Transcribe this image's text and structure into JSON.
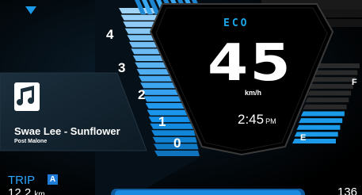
{
  "speedometer": {
    "ticks": [
      "0",
      "1",
      "2",
      "3",
      "4"
    ],
    "speed": "45",
    "unit": "km/h",
    "mode": "ECO"
  },
  "clock": {
    "time": "2:45",
    "ampm": "PM"
  },
  "media": {
    "title": "Swae Lee - Sunflower",
    "artist": "Post Malone",
    "icon": "music-note-icon"
  },
  "trip": {
    "label": "TRIP",
    "badge": "A",
    "value": "12.2",
    "unit": "km"
  },
  "odometer": {
    "value": "136"
  },
  "fuel": {
    "full_label": "F",
    "empty_label": "E"
  },
  "colors": {
    "accent": "#1aa6e8",
    "background": "#000000"
  }
}
